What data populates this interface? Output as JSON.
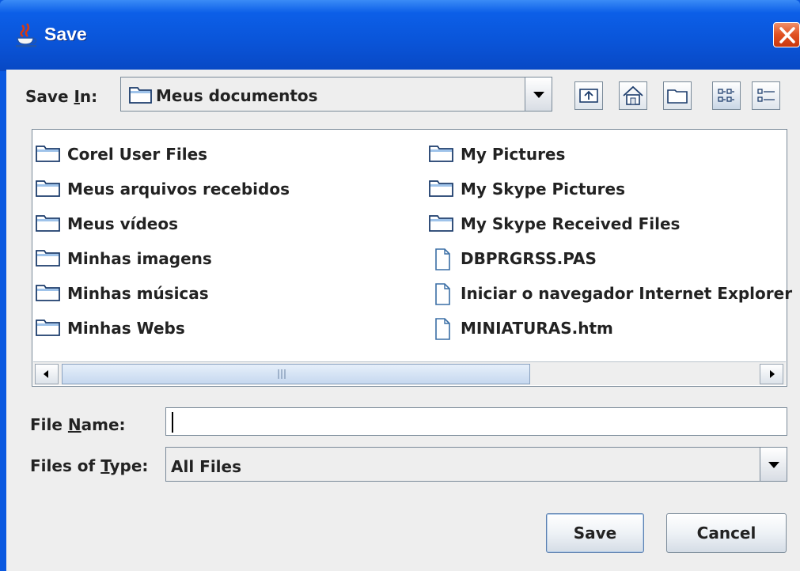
{
  "window": {
    "title": "Save"
  },
  "save_in": {
    "label_pre": "Save ",
    "label_mnemonic": "I",
    "label_post": "n:",
    "value": "Meus documentos"
  },
  "toolbar": {
    "buttons": [
      {
        "icon": "up-one-level-icon"
      },
      {
        "icon": "home-icon"
      },
      {
        "icon": "create-new-folder-icon"
      },
      {
        "icon": "list-view-icon",
        "active": true
      },
      {
        "icon": "details-view-icon"
      }
    ]
  },
  "files": {
    "items": [
      {
        "name": "Corel User Files",
        "icon": "folder-icon"
      },
      {
        "name": "Meus arquivos recebidos",
        "icon": "folder-icon"
      },
      {
        "name": "Meus vídeos",
        "icon": "folder-icon"
      },
      {
        "name": "Minhas imagens",
        "icon": "folder-icon"
      },
      {
        "name": "Minhas músicas",
        "icon": "folder-icon"
      },
      {
        "name": "Minhas Webs",
        "icon": "folder-icon"
      },
      {
        "name": "My Pictures",
        "icon": "folder-icon"
      },
      {
        "name": "My Skype Pictures",
        "icon": "folder-icon"
      },
      {
        "name": "My Skype Received Files",
        "icon": "folder-icon"
      },
      {
        "name": "DBPRGRSS.PAS",
        "icon": "file-icon"
      },
      {
        "name": "Iniciar o navegador Internet Explorer",
        "icon": "file-icon"
      },
      {
        "name": "MINIATURAS.htm",
        "icon": "file-icon"
      }
    ]
  },
  "file_name": {
    "label_pre": "File ",
    "label_mnemonic": "N",
    "label_post": "ame:",
    "value": ""
  },
  "file_type": {
    "label_pre": "Files of ",
    "label_mnemonic": "T",
    "label_post": "ype:",
    "value": "All Files"
  },
  "actions": {
    "save_label": "Save",
    "cancel_label": "Cancel"
  },
  "colors": {
    "titlebar": "#0a54d8",
    "dialog_bg": "#eeeeee",
    "close_button": "#e05020"
  }
}
